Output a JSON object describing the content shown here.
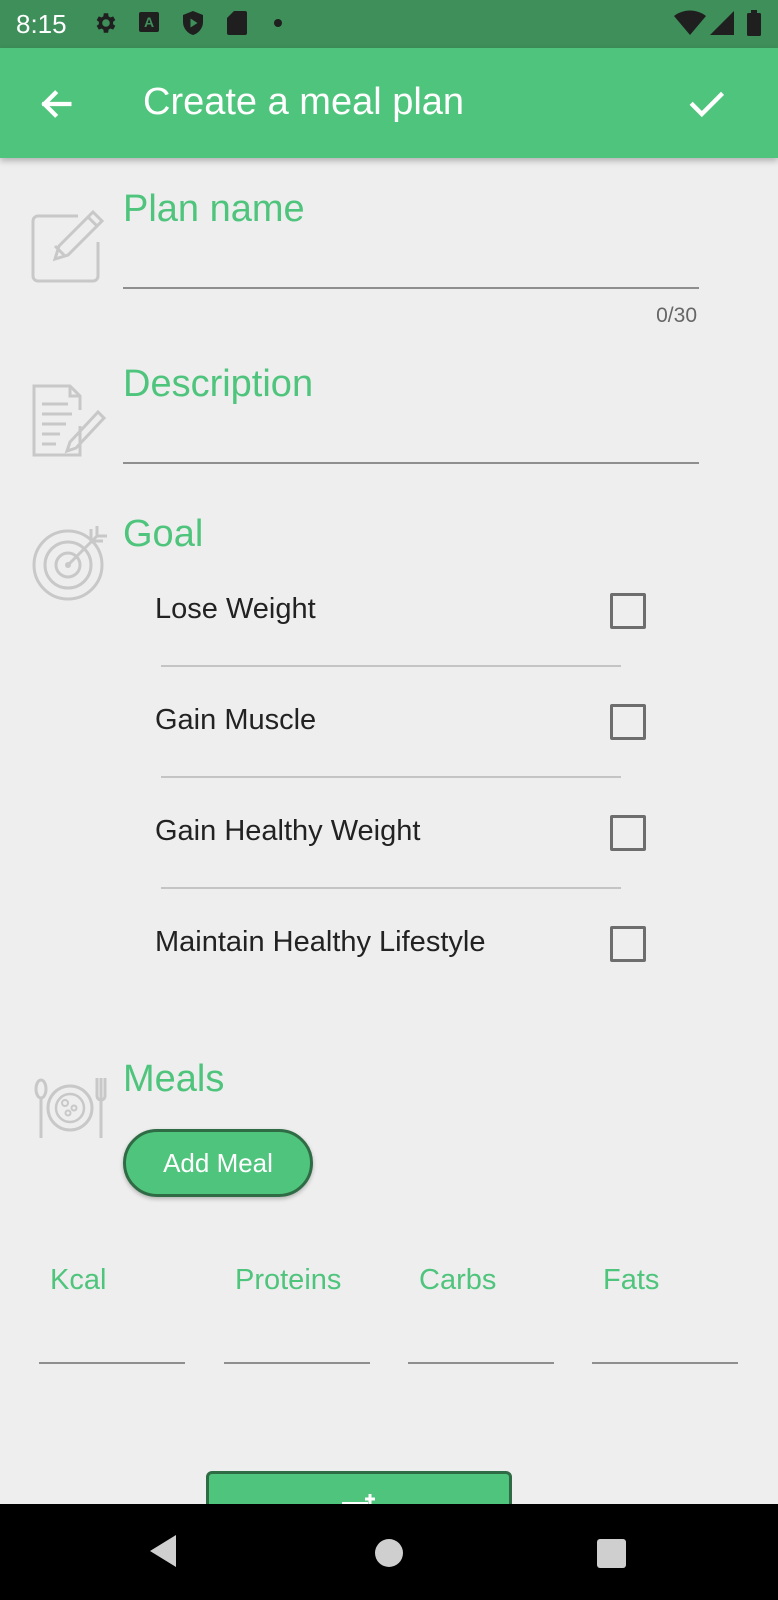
{
  "status_bar": {
    "time": "8:15",
    "left_icons": [
      "settings-icon",
      "text-a-icon",
      "shield-play-icon",
      "sd-card-icon",
      "dot-icon"
    ],
    "right_icons": [
      "wifi-icon",
      "signal-icon",
      "battery-icon"
    ]
  },
  "app_bar": {
    "title": "Create a meal plan",
    "back_icon": "arrow-back-icon",
    "confirm_icon": "check-icon"
  },
  "form": {
    "plan_name": {
      "label": "Plan name",
      "value": "",
      "counter": "0/30",
      "icon": "edit-icon"
    },
    "description": {
      "label": "Description",
      "value": "",
      "icon": "document-edit-icon"
    },
    "goal": {
      "label": "Goal",
      "icon": "target-icon",
      "options": [
        {
          "label": "Lose Weight",
          "checked": false
        },
        {
          "label": "Gain Muscle",
          "checked": false
        },
        {
          "label": "Gain Healthy Weight",
          "checked": false
        },
        {
          "label": "Maintain Healthy Lifestyle",
          "checked": false
        }
      ]
    },
    "meals": {
      "label": "Meals",
      "icon": "meal-plate-icon",
      "add_button": "Add Meal"
    },
    "nutrition": {
      "kcal": {
        "label": "Kcal",
        "value": ""
      },
      "proteins": {
        "label": "Proteins",
        "value": ""
      },
      "carbs": {
        "label": "Carbs",
        "value": ""
      },
      "fats": {
        "label": "Fats",
        "value": ""
      }
    }
  },
  "colors": {
    "accent": "#4fc47c",
    "status_bar": "#3e8f5a",
    "button_border": "#2f6b45",
    "background": "#eeeeee"
  },
  "nav_bar": {
    "icons": [
      "nav-back-icon",
      "nav-home-icon",
      "nav-recents-icon"
    ]
  }
}
